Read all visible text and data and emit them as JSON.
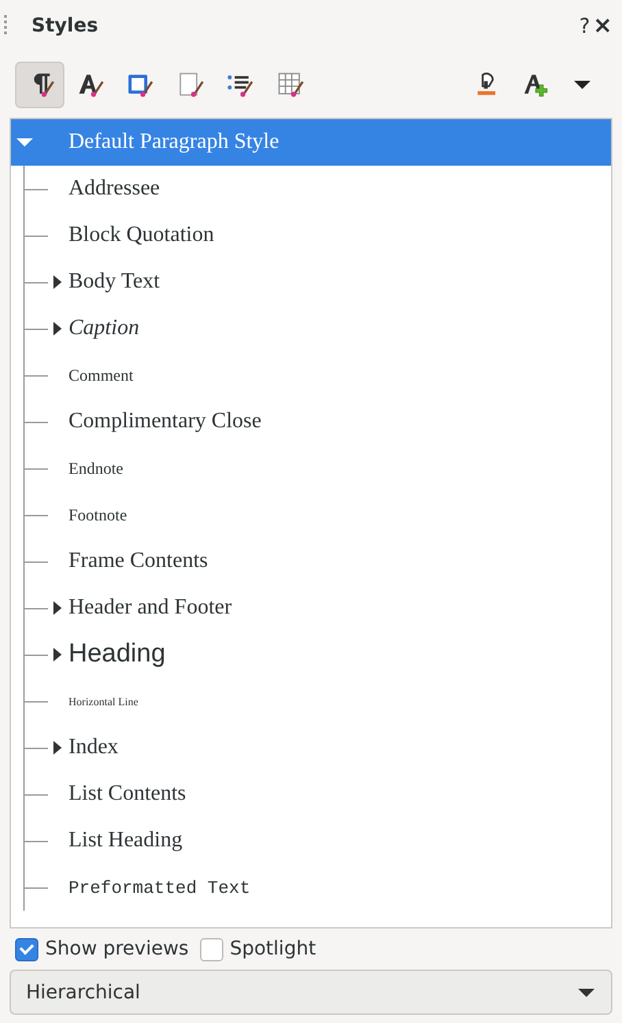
{
  "panel": {
    "title": "Styles",
    "help": "?",
    "close": "×"
  },
  "toolbar": [
    {
      "kind": "paragraph",
      "selected": true
    },
    {
      "kind": "character",
      "selected": false
    },
    {
      "kind": "frame",
      "selected": false
    },
    {
      "kind": "page",
      "selected": false
    },
    {
      "kind": "list",
      "selected": false
    },
    {
      "kind": "table",
      "selected": false
    }
  ],
  "actions": [
    {
      "kind": "fill"
    },
    {
      "kind": "new"
    },
    {
      "kind": "menu"
    }
  ],
  "tree": [
    {
      "label": "Default Paragraph Style",
      "kind": "body",
      "selected": true,
      "expanded": true,
      "children": [
        {
          "label": "Addressee",
          "kind": "body",
          "selected": false
        },
        {
          "label": "Block Quotation",
          "kind": "body",
          "selected": false
        },
        {
          "label": "Body Text",
          "kind": "body",
          "selected": false,
          "expanded": false
        },
        {
          "label": "Caption",
          "kind": "italic",
          "selected": false,
          "expanded": false
        },
        {
          "label": "Comment",
          "kind": "small",
          "selected": false
        },
        {
          "label": "Complimentary Close",
          "kind": "body",
          "selected": false
        },
        {
          "label": "Endnote",
          "kind": "small",
          "selected": false
        },
        {
          "label": "Footnote",
          "kind": "small",
          "selected": false
        },
        {
          "label": "Frame Contents",
          "kind": "body",
          "selected": false
        },
        {
          "label": "Header and Footer",
          "kind": "body",
          "selected": false,
          "expanded": false
        },
        {
          "label": "Heading",
          "kind": "heading",
          "selected": false,
          "expanded": false
        },
        {
          "label": "Horizontal Line",
          "kind": "tiny",
          "selected": false
        },
        {
          "label": "Index",
          "kind": "body",
          "selected": false,
          "expanded": false
        },
        {
          "label": "List Contents",
          "kind": "body",
          "selected": false
        },
        {
          "label": "List Heading",
          "kind": "body",
          "selected": false
        },
        {
          "label": "Preformatted Text",
          "kind": "mono",
          "selected": false
        }
      ]
    }
  ],
  "options": [
    {
      "label": "Show previews",
      "checked": true
    },
    {
      "label": "Spotlight",
      "checked": false
    }
  ],
  "filter": {
    "value": "Hierarchical"
  }
}
